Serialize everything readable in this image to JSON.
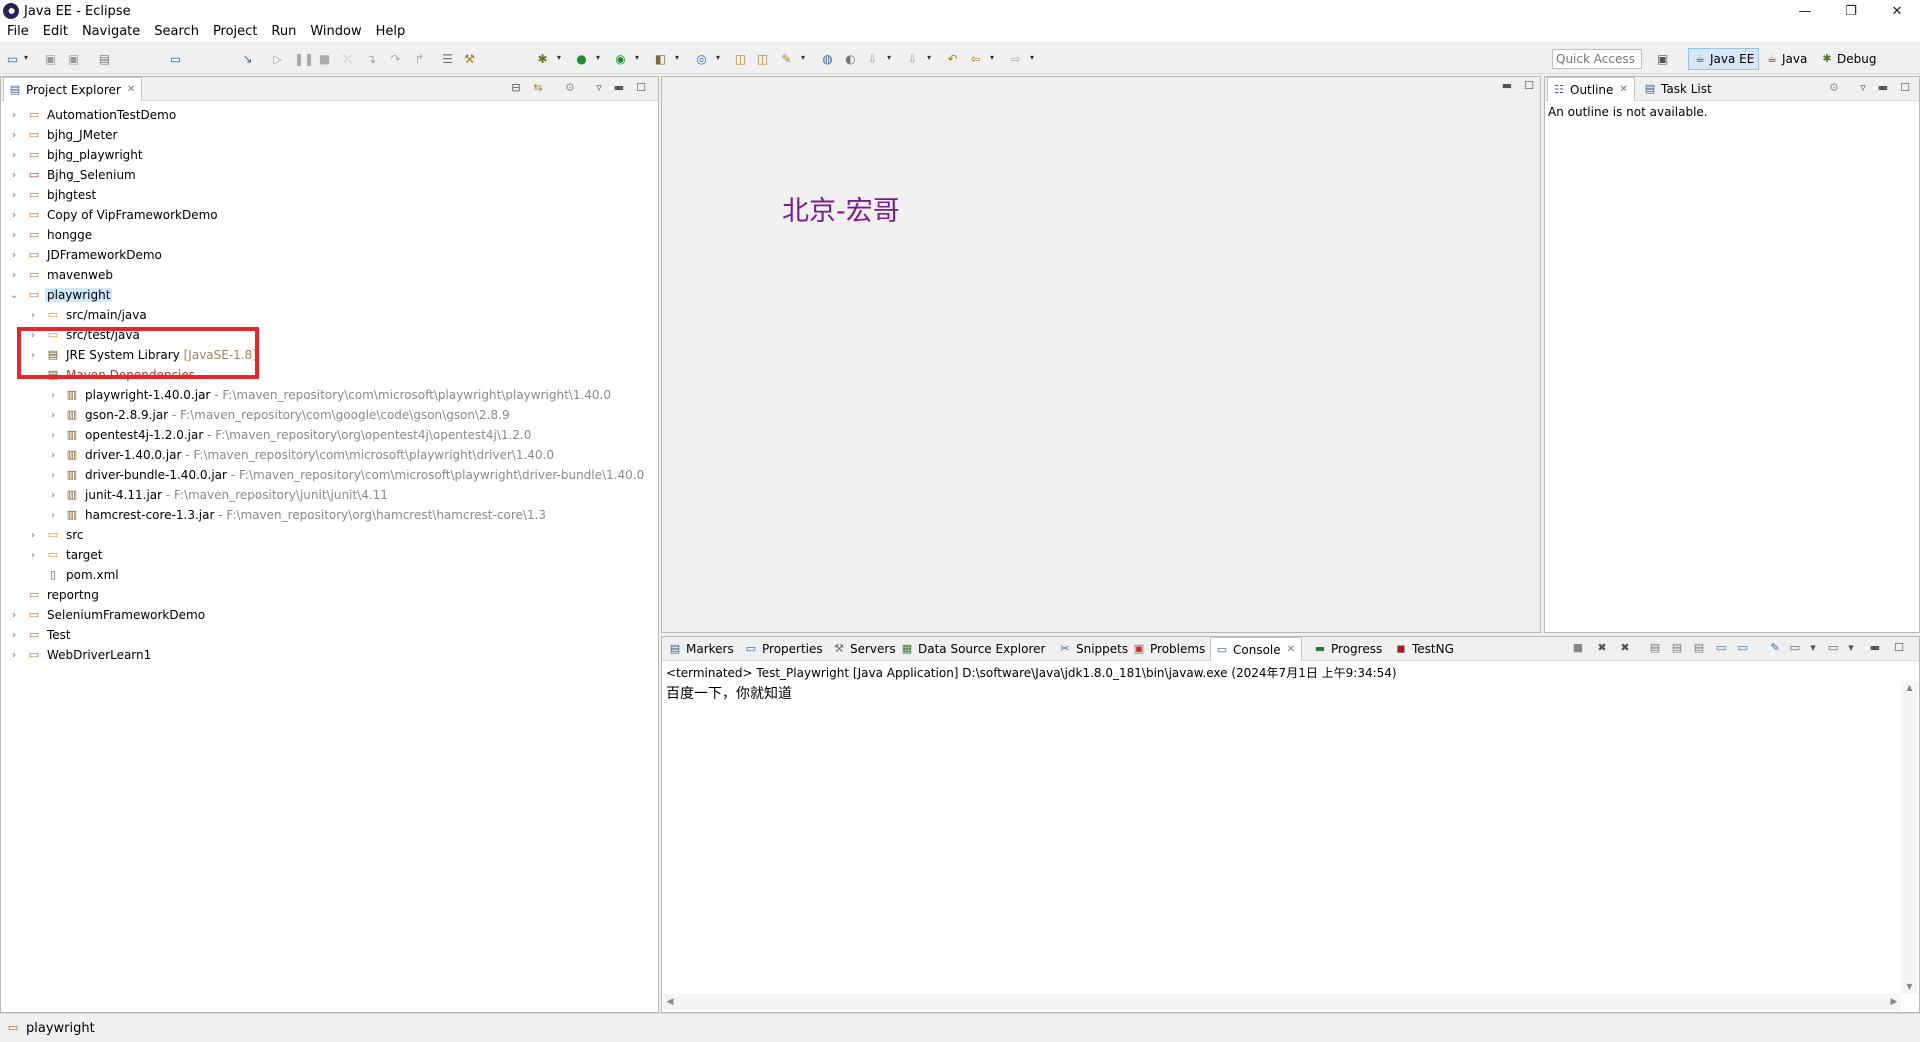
{
  "window": {
    "title": "Java EE - Eclipse",
    "controls": [
      "—",
      "❐",
      "✕"
    ]
  },
  "menu": [
    "File",
    "Edit",
    "Navigate",
    "Search",
    "Project",
    "Run",
    "Window",
    "Help"
  ],
  "toolbar": {
    "quick_access_placeholder": "Quick Access",
    "perspectives": [
      "Java EE",
      "Java",
      "Debug"
    ],
    "active_perspective": "Java EE"
  },
  "project_explorer": {
    "tab_label": "Project Explorer",
    "projects": [
      "AutomationTestDemo",
      "bjhg_JMeter",
      "bjhg_playwright",
      "Bjhg_Selenium",
      "bjhgtest",
      "Copy of VipFrameworkDemo",
      "hongge",
      "JDFrameworkDemo",
      "mavenweb"
    ],
    "expanded_project": "playwright",
    "children": {
      "src_main": "src/main/java",
      "src_test": "src/test/java",
      "jre": "JRE System Library",
      "jre_decoration": "[JavaSE-1.8]",
      "maven": "Maven Dependencies"
    },
    "jars": [
      {
        "name": "playwright-1.40.0.jar",
        "path": "- F:\\maven_repository\\com\\microsoft\\playwright\\playwright\\1.40.0"
      },
      {
        "name": "gson-2.8.9.jar",
        "path": "- F:\\maven_repository\\com\\google\\code\\gson\\gson\\2.8.9"
      },
      {
        "name": "opentest4j-1.2.0.jar",
        "path": "- F:\\maven_repository\\org\\opentest4j\\opentest4j\\1.2.0"
      },
      {
        "name": "driver-1.40.0.jar",
        "path": "- F:\\maven_repository\\com\\microsoft\\playwright\\driver\\1.40.0"
      },
      {
        "name": "driver-bundle-1.40.0.jar",
        "path": "- F:\\maven_repository\\com\\microsoft\\playwright\\driver-bundle\\1.40.0"
      },
      {
        "name": "junit-4.11.jar",
        "path": "- F:\\maven_repository\\junit\\junit\\4.11"
      },
      {
        "name": "hamcrest-core-1.3.jar",
        "path": "- F:\\maven_repository\\org\\hamcrest\\hamcrest-core\\1.3"
      }
    ],
    "folders": [
      "src",
      "target"
    ],
    "pom": "pom.xml",
    "after_projects": [
      "reportng",
      "SeleniumFrameworkDemo",
      "Test",
      "WebDriverLearn1"
    ]
  },
  "editor": {
    "watermark": "北京-宏哥"
  },
  "outline": {
    "tabs": [
      "Outline",
      "Task List"
    ],
    "message": "An outline is not available."
  },
  "bottom_panel": {
    "tabs": [
      "Markers",
      "Properties",
      "Servers",
      "Data Source Explorer",
      "Snippets",
      "Problems",
      "Console",
      "Progress",
      "TestNG"
    ],
    "active_tab": "Console",
    "terminated_line": "<terminated> Test_Playwright [Java Application] D:\\software\\Java\\jdk1.8.0_181\\bin\\javaw.exe (2024年7月1日 上午9:34:54)",
    "output": "百度一下，你就知道"
  },
  "status": {
    "selection": "playwright"
  }
}
